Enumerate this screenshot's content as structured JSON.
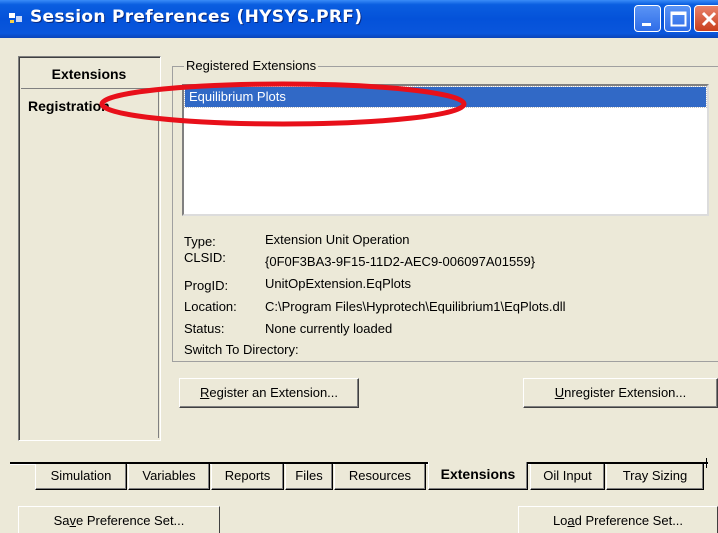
{
  "window": {
    "title": "Session Preferences (HYSYS.PRF)"
  },
  "left": {
    "header": "Extensions",
    "items": [
      "Registration"
    ]
  },
  "registered": {
    "group_label": "Registered Extensions",
    "items": [
      {
        "label": "Equilibrium Plots",
        "selected": true
      }
    ]
  },
  "info": {
    "type_label": "Type:",
    "type_value": "Extension Unit Operation",
    "clsid_label": "CLSID:",
    "clsid_value": "{0F0F3BA3-9F15-11D2-AEC9-006097A01559}",
    "progid_label": "ProgID:",
    "progid_value": "UnitOpExtension.EqPlots",
    "location_label": "Location:",
    "location_value": "C:\\Program Files\\Hyprotech\\Equilibrium1\\EqPlots.dll",
    "status_label": "Status:",
    "status_value": "None currently loaded",
    "switch_label": "Switch To Directory:"
  },
  "buttons": {
    "register_pre": "",
    "register_key": "R",
    "register_post": "egister an Extension...",
    "unregister_pre": "",
    "unregister_key": "U",
    "unregister_post": "nregister Extension...",
    "save_pre": "Sa",
    "save_key": "v",
    "save_post": "e Preference Set...",
    "load_pre": "Lo",
    "load_key": "a",
    "load_post": "d Preference Set..."
  },
  "tabs": [
    {
      "label": "Simulation",
      "active": false
    },
    {
      "label": "Variables",
      "active": false
    },
    {
      "label": "Reports",
      "active": false
    },
    {
      "label": "Files",
      "active": false
    },
    {
      "label": "Resources",
      "active": false
    },
    {
      "label": "Extensions",
      "active": true
    },
    {
      "label": "Oil Input",
      "active": false
    },
    {
      "label": "Tray Sizing",
      "active": false
    }
  ],
  "colors": {
    "titlebar": "#0452d9",
    "selection": "#3169c6",
    "annotation": "#e8101a",
    "face": "#ece9d8"
  }
}
